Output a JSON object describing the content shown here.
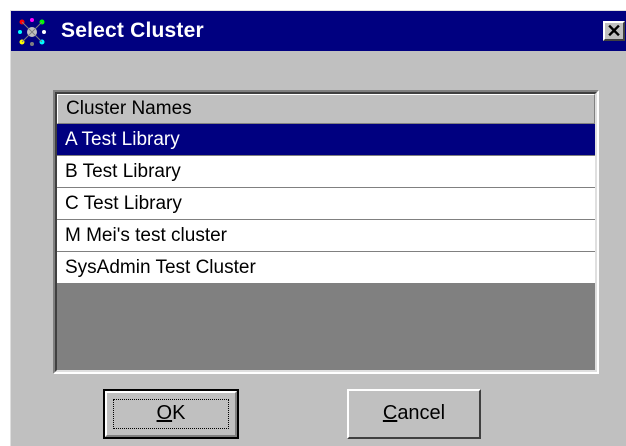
{
  "dialog": {
    "title": "Select Cluster",
    "close_label": "✕"
  },
  "list": {
    "header": "Cluster Names",
    "items": [
      "A Test Library",
      "B Test Library",
      "C Test Library",
      "M Mei's test cluster",
      "SysAdmin Test Cluster"
    ],
    "selected_index": 0
  },
  "buttons": {
    "ok": {
      "mnemonic": "O",
      "rest": "K"
    },
    "cancel": {
      "mnemonic": "C",
      "rest": "ancel"
    }
  },
  "colors": {
    "titlebar": "#000080",
    "dialog_face": "#c0c0c0",
    "selection": "#000080",
    "list_empty_area": "#808080"
  }
}
